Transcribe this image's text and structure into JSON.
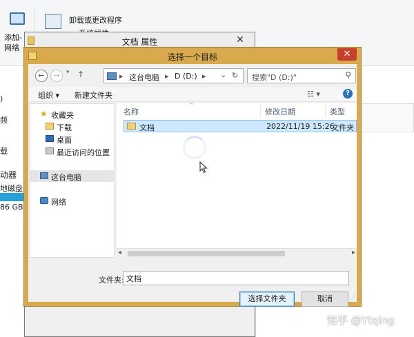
{
  "background": {
    "ribbon_item_1": "卸载或更改程序",
    "ribbon_item_2": "系统属性",
    "ribbon_add": "添加-",
    "ribbon_net": "网络",
    "left_labels": [
      ")",
      "频",
      "载",
      "动器",
      "地磁盘",
      "86 GB"
    ]
  },
  "properties_window": {
    "title": "文档 属性",
    "close_glyph": "✕"
  },
  "dialog": {
    "title": "选择一个目标",
    "close_glyph": "✕",
    "nav": {
      "back": "←",
      "forward": "→",
      "up": "↑"
    },
    "address": {
      "crumb_1": "这台电脑",
      "crumb_2": "D (D:)",
      "sep": "▸",
      "dropdown": "⌄",
      "refresh": "↻"
    },
    "search": {
      "placeholder": "搜索\"D (D:)\"",
      "icon": "⚲"
    },
    "command_bar": {
      "organize": "组织 ▾",
      "new_folder": "新建文件夹",
      "view": "☷ ▾",
      "help": "?"
    },
    "nav_pane": {
      "favorites": "收藏夹",
      "downloads": "下载",
      "desktop": "桌面",
      "recent": "最近访问的位置",
      "this_pc": "这台电脑",
      "network": "网络"
    },
    "file_list": {
      "columns": {
        "name": "名称",
        "modified": "修改日期",
        "type": "类型"
      },
      "sort_indicator": "^",
      "rows": [
        {
          "name": "文档",
          "modified": "2022/11/19 15:26",
          "type": "文件夹"
        }
      ]
    },
    "scroll": {
      "left": "◂",
      "right": "▸"
    },
    "folder_label": "文件夹:",
    "folder_value": "文档",
    "select_button": "选择文件夹",
    "cancel_button": "取消"
  },
  "watermark": "知乎 @Ytqing",
  "colors": {
    "dialog_frame": "#d8a94d",
    "close_red": "#c7402b",
    "selection": "#cde8ff",
    "accent": "#26a0da"
  }
}
